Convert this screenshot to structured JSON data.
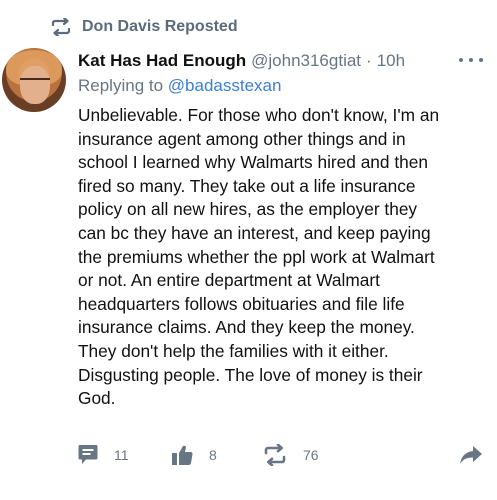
{
  "repost": {
    "label": "Don Davis Reposted",
    "icon": "repost-icon"
  },
  "post": {
    "author_name": "Kat Has Had Enough",
    "author_handle": "@john316gtiat",
    "separator": "·",
    "time": "10h",
    "replying_prefix": "Replying to",
    "replying_to": "@badasstexan",
    "text": "Unbelievable. For those who don't know, I'm an\ninsurance agent among other things and in\nschool I learned why Walmarts hired and then\nfired so many. They take out a life insurance\npolicy on all new hires, as the employer they\ncan bc they have an interest, and keep paying\nthe premiums whether the ppl work at Walmart\nor not. An entire department at Walmart\nheadquarters follows obituaries and file life\ninsurance claims. And they keep the money.\nThey don't help the families with it either.\nDisgusting people. The love of money is their\nGod."
  },
  "actions": {
    "comments": "11",
    "likes": "8",
    "reposts": "76"
  },
  "icons": {
    "comment": "comment-icon",
    "like": "thumbs-up-icon",
    "repost": "repost-icon",
    "share": "share-arrow-icon",
    "more": "more-dots-icon"
  },
  "colors": {
    "muted": "#687684",
    "mention": "#3b7fd6",
    "text": "#111111"
  }
}
